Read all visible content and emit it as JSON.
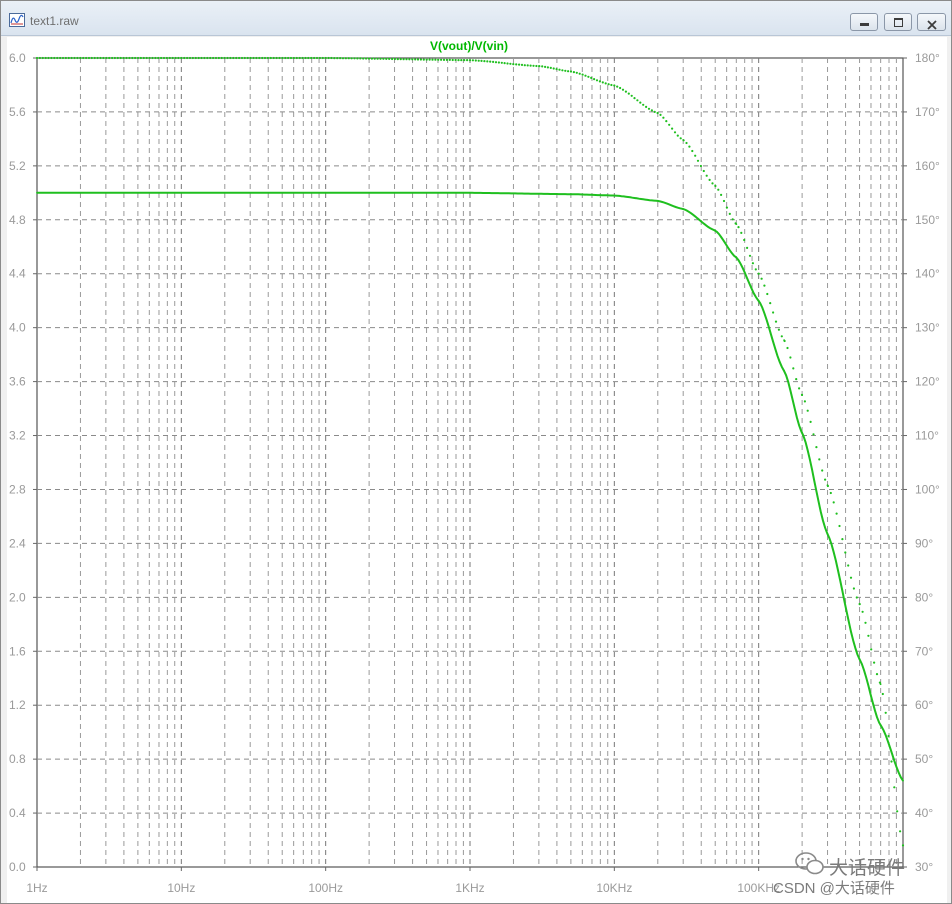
{
  "window": {
    "title": "text1.raw",
    "icons": {
      "app": "waveform-icon",
      "minimize": "minimize-icon",
      "maximize": "maximize-icon",
      "close": "close-icon"
    }
  },
  "watermark": {
    "brand": "大话硬件",
    "credit": "CSDN @大话硬件",
    "logo_icon": "wechat-icon"
  },
  "chart_data": {
    "type": "line",
    "title": "V(vout)/V(vin)",
    "x_scale": "log",
    "xlim": [
      1,
      1000000
    ],
    "x_ticks": [
      {
        "value": 1,
        "label": "1Hz"
      },
      {
        "value": 10,
        "label": "10Hz"
      },
      {
        "value": 100,
        "label": "100Hz"
      },
      {
        "value": 1000,
        "label": "1KHz"
      },
      {
        "value": 10000,
        "label": "10KHz"
      },
      {
        "value": 100000,
        "label": "100KHz"
      }
    ],
    "ylim": [
      0,
      6
    ],
    "y_ticks": [
      "0.0",
      "0.4",
      "0.8",
      "1.2",
      "1.6",
      "2.0",
      "2.4",
      "2.8",
      "3.2",
      "3.6",
      "4.0",
      "4.4",
      "4.8",
      "5.2",
      "5.6",
      "6.0"
    ],
    "y2lim": [
      30,
      180
    ],
    "y2_ticks": [
      "30°",
      "40°",
      "50°",
      "60°",
      "70°",
      "80°",
      "90°",
      "100°",
      "110°",
      "120°",
      "130°",
      "140°",
      "150°",
      "160°",
      "170°",
      "180°"
    ],
    "grid": true,
    "color": "#1fbf1f",
    "series": [
      {
        "style": "solid",
        "axis": "left",
        "x": [
          1,
          100,
          1000,
          5000,
          10000,
          20000,
          30000,
          50000,
          70000,
          100000,
          150000,
          200000,
          300000,
          500000,
          700000,
          1000000
        ],
        "values": [
          5.0,
          5.0,
          5.0,
          4.99,
          4.98,
          4.94,
          4.88,
          4.72,
          4.52,
          4.2,
          3.68,
          3.22,
          2.47,
          1.54,
          1.05,
          0.64
        ]
      },
      {
        "style": "dotted",
        "axis": "right",
        "x": [
          1,
          100,
          1000,
          3000,
          5000,
          10000,
          20000,
          30000,
          50000,
          70000,
          100000,
          150000,
          200000,
          300000,
          500000,
          700000,
          1000000
        ],
        "values": [
          180,
          180,
          179.6,
          178.5,
          177.5,
          174.9,
          169.8,
          164.8,
          156.3,
          149.2,
          140.0,
          127.7,
          117.5,
          100.8,
          78.8,
          63.9,
          34.0
        ]
      }
    ]
  }
}
